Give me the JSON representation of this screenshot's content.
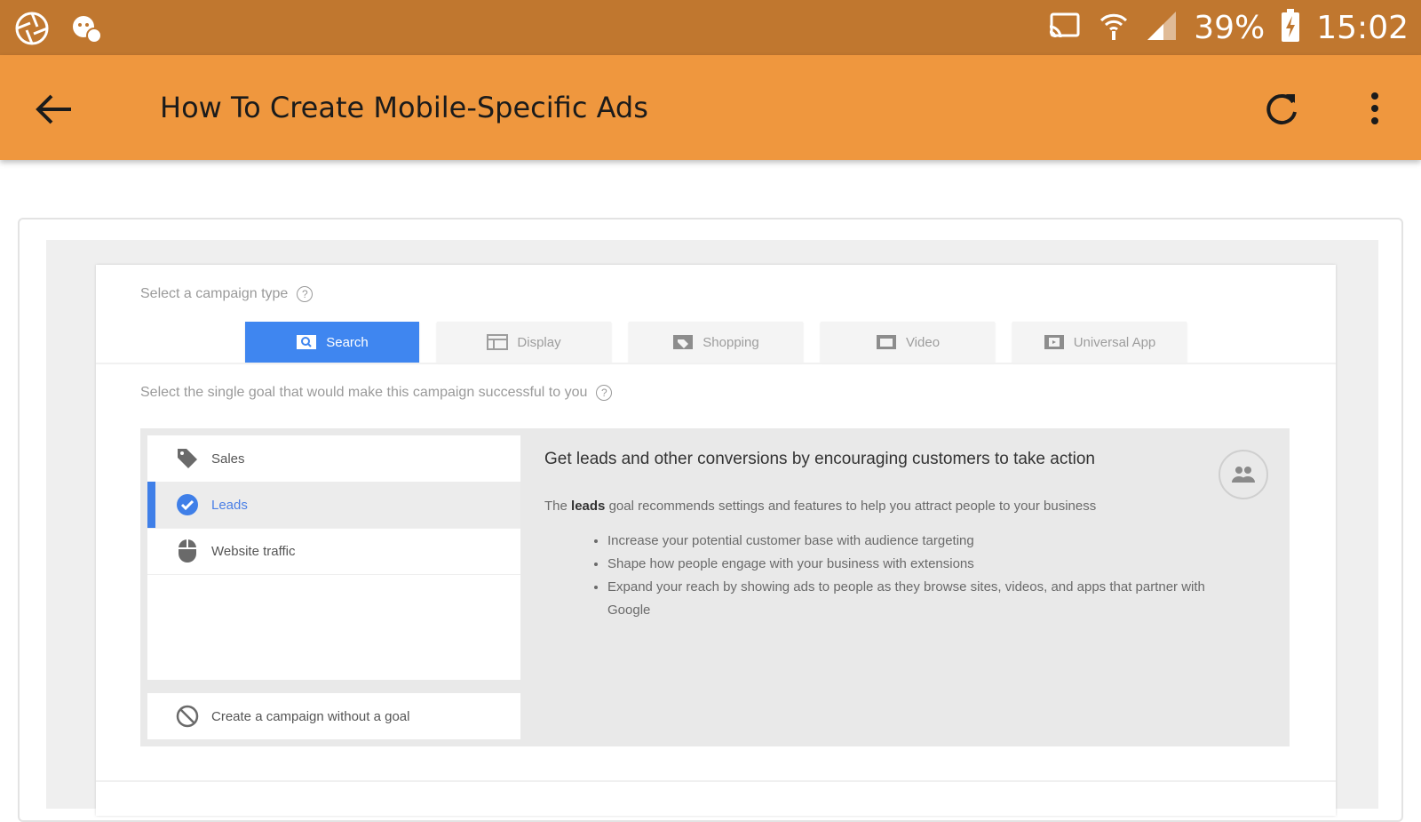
{
  "status_bar": {
    "battery": "39%",
    "time": "15:02",
    "icons": [
      "aperture-icon",
      "notification-icon",
      "cast-icon",
      "wifi-icon",
      "signal-icon",
      "battery-charging-icon"
    ]
  },
  "app_bar": {
    "title": "How To Create Mobile-Specific Ads",
    "icons": [
      "back-arrow-icon",
      "refresh-icon",
      "more-vert-icon"
    ]
  },
  "campaign": {
    "type_label": "Select a campaign type",
    "tabs": [
      {
        "label": "Search",
        "icon": "search-icon",
        "active": true
      },
      {
        "label": "Display",
        "icon": "display-icon",
        "active": false
      },
      {
        "label": "Shopping",
        "icon": "shopping-icon",
        "active": false
      },
      {
        "label": "Video",
        "icon": "video-icon",
        "active": false
      },
      {
        "label": "Universal App",
        "icon": "app-icon",
        "active": false
      }
    ],
    "goal_label": "Select the single goal that would make this campaign successful to you",
    "goals": [
      {
        "label": "Sales",
        "icon": "tag-icon",
        "selected": false
      },
      {
        "label": "Leads",
        "icon": "check-circle-icon",
        "selected": true
      },
      {
        "label": "Website traffic",
        "icon": "mouse-icon",
        "selected": false
      }
    ],
    "no_goal": "Create a campaign without a goal",
    "detail": {
      "title": "Get leads and other conversions by encouraging customers to take action",
      "desc_prefix": "The",
      "desc_bold": "leads",
      "desc_suffix": "goal recommends settings and features to help you attract people to your business",
      "bullets": [
        "Increase your potential customer base with audience targeting",
        "Shape how people engage with your business with extensions",
        "Expand your reach by showing ads to people as they browse sites, videos, and apps that partner with Google"
      ]
    }
  },
  "colors": {
    "status_bar": "#c0772f",
    "app_bar": "#ef973e",
    "active_tab": "#3f86f0",
    "selected_goal": "#4a7fe6"
  }
}
